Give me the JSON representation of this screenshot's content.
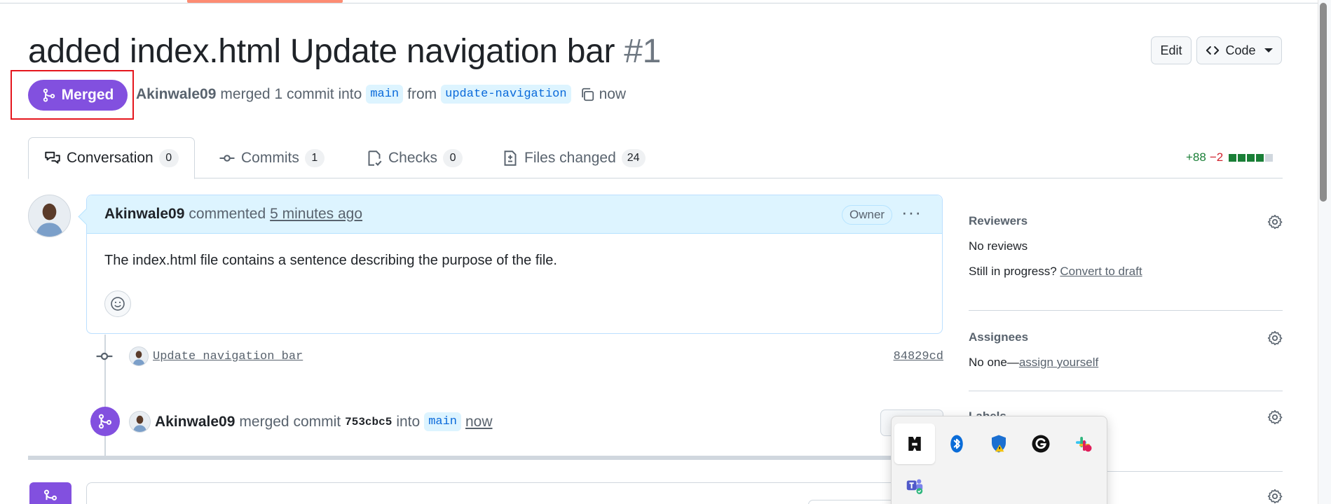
{
  "pr": {
    "title": "added index.html Update navigation bar",
    "number": "#1",
    "edit_label": "Edit",
    "code_label": "Code",
    "state": "Merged",
    "author": "Akinwale09",
    "action_text": "merged 1 commit into",
    "base_branch": "main",
    "from_text": "from",
    "head_branch": "update-navigation",
    "time": "now"
  },
  "tabs": [
    {
      "label": "Conversation",
      "count": "0",
      "icon": "conversation-icon"
    },
    {
      "label": "Commits",
      "count": "1",
      "icon": "commit-icon"
    },
    {
      "label": "Checks",
      "count": "0",
      "icon": "checklist-icon"
    },
    {
      "label": "Files changed",
      "count": "24",
      "icon": "file-diff-icon"
    }
  ],
  "diffstat": {
    "additions": "+88",
    "deletions": "−2"
  },
  "comment": {
    "author": "Akinwale09",
    "action": "commented",
    "time": "5 minutes ago",
    "role_badge": "Owner",
    "body": "The index.html file contains a sentence describing the purpose of the file."
  },
  "commit": {
    "message": "Update navigation bar",
    "sha": "84829cd"
  },
  "merge_event": {
    "author": "Akinwale09",
    "action": "merged commit",
    "sha": "753cbc5",
    "into_text": "into",
    "branch": "main",
    "time": "now"
  },
  "sidebar": {
    "reviewers": {
      "title": "Reviewers",
      "value": "No reviews",
      "draft_prompt": "Still in progress?",
      "draft_link": "Convert to draft"
    },
    "assignees": {
      "title": "Assignees",
      "value": "No one—",
      "assign_link": "assign yourself"
    },
    "labels": {
      "title": "Labels"
    }
  },
  "tray": {
    "icons": [
      "bitdefender-icon",
      "bluetooth-icon",
      "windows-security-icon",
      "grammarly-icon",
      "slack-icon",
      "teams-icon"
    ]
  },
  "colors": {
    "merged_purple": "#8250df",
    "accent_blue": "#0969da",
    "addition_green": "#1a7f37",
    "deletion_red": "#d1242f",
    "highlight_red": "#e5161d"
  }
}
